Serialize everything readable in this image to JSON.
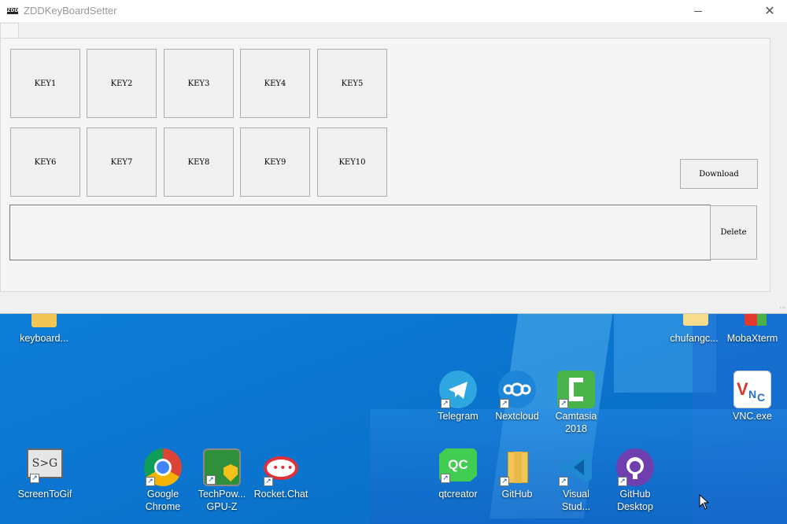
{
  "window": {
    "icon_text": "ZDD",
    "title": "ZDDKeyBoardSetter",
    "close_glyph": "✕"
  },
  "keys": [
    {
      "label": "KEY1"
    },
    {
      "label": "KEY2"
    },
    {
      "label": "KEY3"
    },
    {
      "label": "KEY4"
    },
    {
      "label": "KEY5"
    },
    {
      "label": "KEY6"
    },
    {
      "label": "KEY7"
    },
    {
      "label": "KEY8"
    },
    {
      "label": "KEY9"
    },
    {
      "label": "KEY10"
    }
  ],
  "actions": {
    "download_label": "Download",
    "delete_label": "Delete"
  },
  "desktop_icons": [
    {
      "label": "keyboard...",
      "icon": "folder-icon"
    },
    {
      "label": "chufangc...",
      "icon": "folder-icon"
    },
    {
      "label": "MobaXterm",
      "icon": "mobaxterm-icon"
    },
    {
      "label": "Telegram",
      "icon": "telegram-icon"
    },
    {
      "label": "Nextcloud",
      "icon": "nextcloud-icon"
    },
    {
      "label": "Camtasia 2018",
      "icon": "camtasia-icon"
    },
    {
      "label": "VNC.exe",
      "icon": "vnc-icon"
    },
    {
      "label": "ScreenToGif",
      "icon": "screentogif-icon",
      "icon_text": "S>G"
    },
    {
      "label": "Google Chrome",
      "icon": "chrome-icon"
    },
    {
      "label": "TechPow... GPU-Z",
      "icon": "gpuz-icon"
    },
    {
      "label": "Rocket.Chat",
      "icon": "rocketchat-icon"
    },
    {
      "label": "qtcreator",
      "icon": "qtcreator-icon",
      "icon_text": "QC"
    },
    {
      "label": "GitHub",
      "icon": "folder-icon"
    },
    {
      "label": "Visual Stud...",
      "icon": "vscode-icon"
    },
    {
      "label": "GitHub Desktop",
      "icon": "github-desktop-icon"
    }
  ],
  "colors": {
    "desktop_blue": "#0c7bd6",
    "window_bg": "#f0f0f0"
  }
}
